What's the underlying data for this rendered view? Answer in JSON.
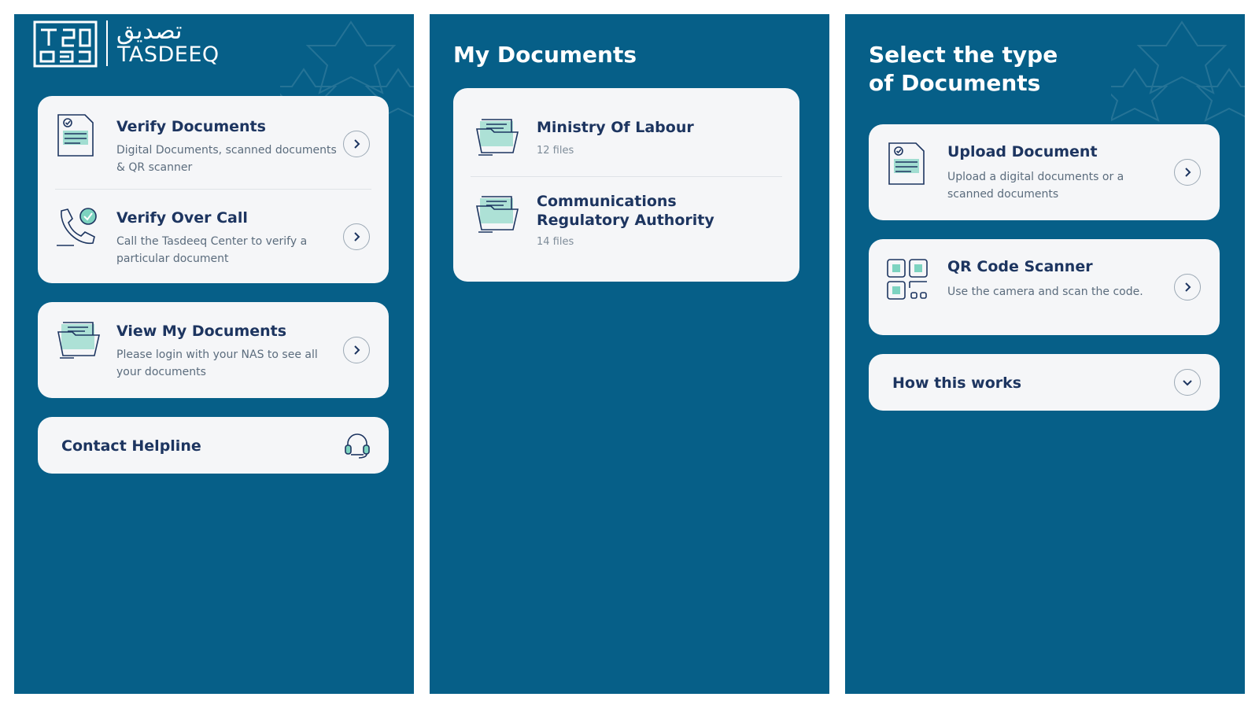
{
  "home": {
    "brand_arabic": "تصديق",
    "brand_name": "TASDEEQ",
    "items": [
      {
        "title": "Verify Documents",
        "description": "Digital Documents, scanned documents & QR scanner",
        "icon": "document-check-icon"
      },
      {
        "title": "Verify Over Call",
        "description": "Call the Tasdeeq Center to verify a particular document",
        "icon": "phone-check-icon"
      },
      {
        "title": "View My Documents",
        "description": "Please login with your NAS to see all your documents",
        "icon": "folder-icon"
      }
    ],
    "helpline_label": "Contact Helpline",
    "helpline_icon": "headset-icon"
  },
  "documents": {
    "title": "My Documents",
    "items": [
      {
        "title": "Ministry Of Labour",
        "count": "12 files",
        "icon": "folder-icon"
      },
      {
        "title": "Communications Regulatory Authority",
        "count": "14 files",
        "icon": "folder-icon"
      }
    ]
  },
  "select": {
    "title": "Select the type of Documents",
    "items": [
      {
        "title": "Upload Document",
        "description": "Upload a digital documents or a scanned documents",
        "icon": "document-check-icon"
      },
      {
        "title": "QR Code Scanner",
        "description": "Use the camera and scan the code.",
        "icon": "qr-code-icon"
      }
    ],
    "how_label": "How this works"
  },
  "colors": {
    "background": "#065f88",
    "card": "#f5f6f8",
    "title_text": "#1d3560",
    "icon_accent": "#7dd3c0"
  }
}
